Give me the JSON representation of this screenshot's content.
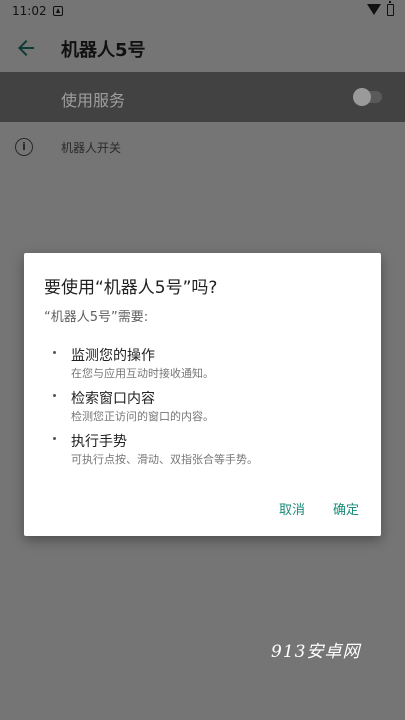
{
  "status_bar": {
    "time": "11:02"
  },
  "app_bar": {
    "title": "机器人5号"
  },
  "switch_bar": {
    "label": "使用服务",
    "enabled": false
  },
  "settings": {
    "robot_switch_label": "机器人开关"
  },
  "dialog": {
    "title": "要使用“机器人5号”吗?",
    "subtitle": "“机器人5号”需要:",
    "permissions": [
      {
        "title": "监测您的操作",
        "desc": "在您与应用互动时接收通知。"
      },
      {
        "title": "检索窗口内容",
        "desc": "检测您正访问的窗口的内容。"
      },
      {
        "title": "执行手势",
        "desc": "可执行点按、滑动、双指张合等手势。"
      }
    ],
    "cancel_label": "取消",
    "ok_label": "确定"
  },
  "colors": {
    "accent": "#1b8a78",
    "scrim": "#757575",
    "switch_bar": "#424242"
  },
  "watermark": "913安卓网"
}
